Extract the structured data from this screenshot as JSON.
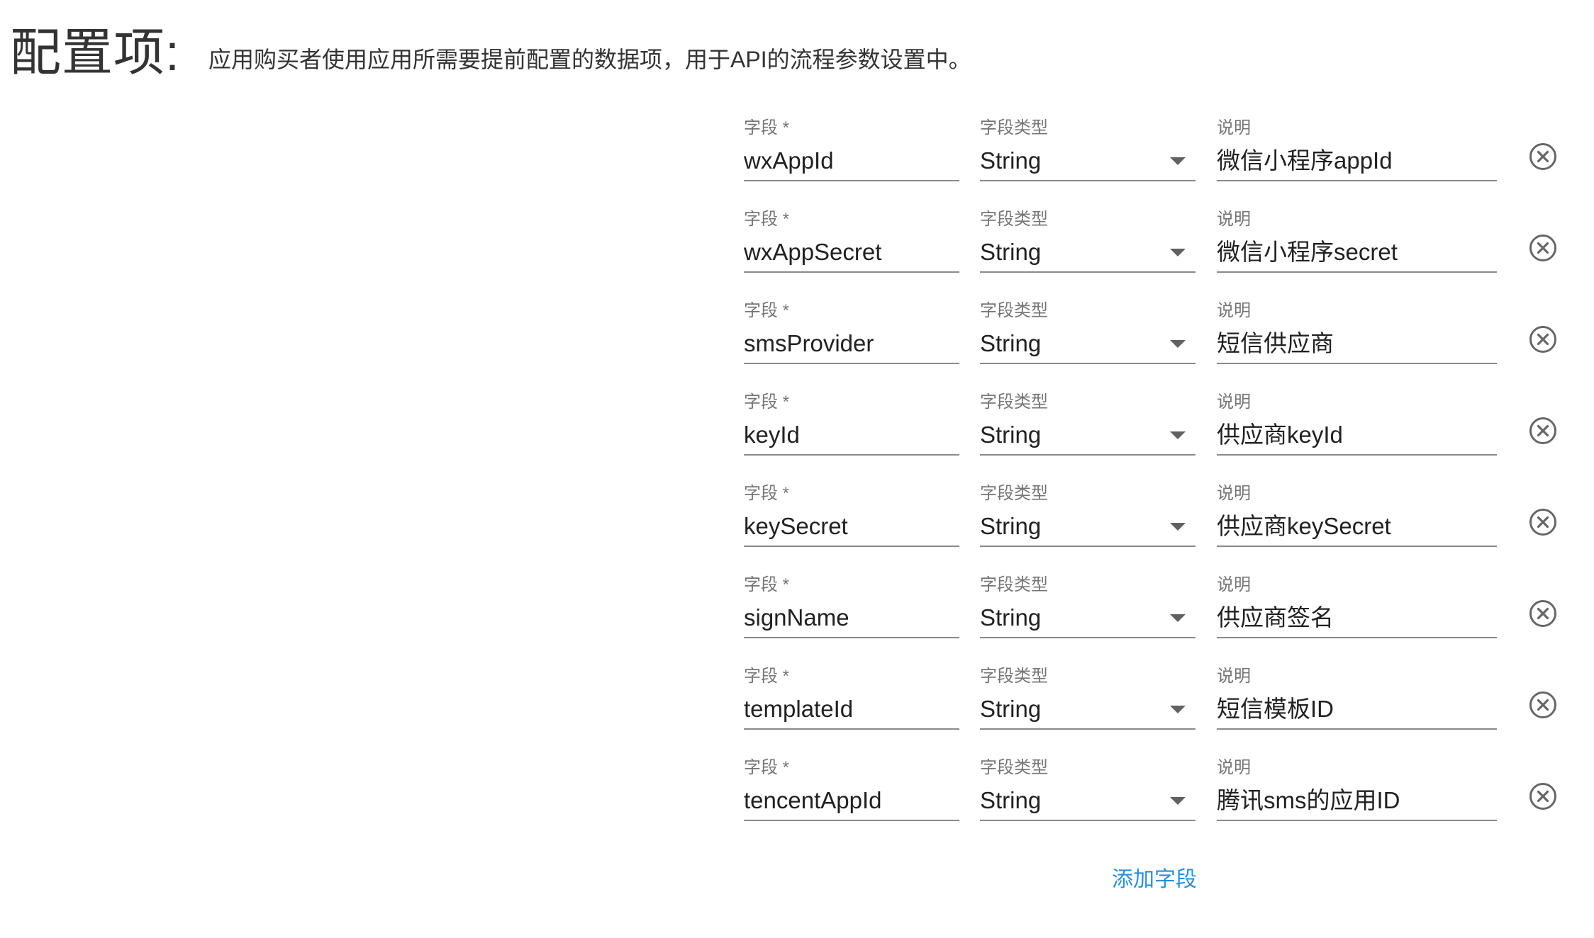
{
  "header": {
    "title": "配置项:",
    "description": "应用购买者使用应用所需要提前配置的数据项，用于API的流程参数设置中。"
  },
  "labels": {
    "field": "字段 *",
    "type": "字段类型",
    "description": "说明"
  },
  "rows": [
    {
      "field": "wxAppId",
      "type": "String",
      "description": "微信小程序appId"
    },
    {
      "field": "wxAppSecret",
      "type": "String",
      "description": "微信小程序secret"
    },
    {
      "field": "smsProvider",
      "type": "String",
      "description": "短信供应商"
    },
    {
      "field": "keyId",
      "type": "String",
      "description": "供应商keyId"
    },
    {
      "field": "keySecret",
      "type": "String",
      "description": "供应商keySecret"
    },
    {
      "field": "signName",
      "type": "String",
      "description": "供应商签名"
    },
    {
      "field": "templateId",
      "type": "String",
      "description": "短信模板ID"
    },
    {
      "field": "tencentAppId",
      "type": "String",
      "description": "腾讯sms的应用ID"
    }
  ],
  "add_field_label": "添加字段",
  "icons": {
    "remove": "close-circle-icon",
    "dropdown": "caret-down-icon"
  },
  "colors": {
    "accent_link": "#2a8fd4",
    "label_gray": "#757575",
    "underline": "#8a8a8a"
  }
}
